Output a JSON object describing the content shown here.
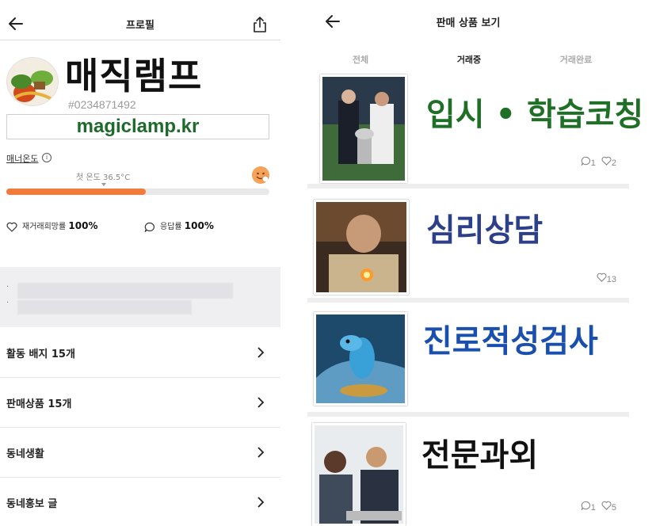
{
  "left": {
    "header": {
      "title": "프로필"
    },
    "profile": {
      "name": "매직램프",
      "id": "#0234871492",
      "site": "magiclamp.kr"
    },
    "manner": {
      "label": "매너온도",
      "first_temp_label": "첫 온도 36.5°C",
      "temperature_fraction": 0.53
    },
    "stats": [
      {
        "label": "재거래희망률",
        "value": "100%",
        "icon": "heart-outline-icon"
      },
      {
        "label": "응답률",
        "value": "100%",
        "icon": "chat-bubble-icon"
      }
    ],
    "blurred_lines": [
      "·",
      "·"
    ],
    "menu": [
      {
        "label": "활동 배지 15개"
      },
      {
        "label": "판매상품 15개"
      },
      {
        "label": "동네생활"
      },
      {
        "label": "동네홍보 글"
      }
    ]
  },
  "right": {
    "header": {
      "title": "판매 상품 보기"
    },
    "tabs": [
      {
        "label": "전체",
        "active": false
      },
      {
        "label": "거래중",
        "active": true
      },
      {
        "label": "거래완료",
        "active": false
      }
    ],
    "items": [
      {
        "title": "입시 • 학습코칭",
        "color": "#1f6f26",
        "chats": "1",
        "likes": "2"
      },
      {
        "title": "심리상담",
        "color": "#2e3f8a",
        "chats": "",
        "likes": "13"
      },
      {
        "title": "진로적성검사",
        "color": "#1a4fae",
        "chats": "",
        "likes": ""
      },
      {
        "title": "전문과외",
        "color": "#111111",
        "chats": "1",
        "likes": "5"
      }
    ]
  },
  "colors": {
    "accent": "#f07b3d",
    "site_green": "#1c6b2a"
  }
}
